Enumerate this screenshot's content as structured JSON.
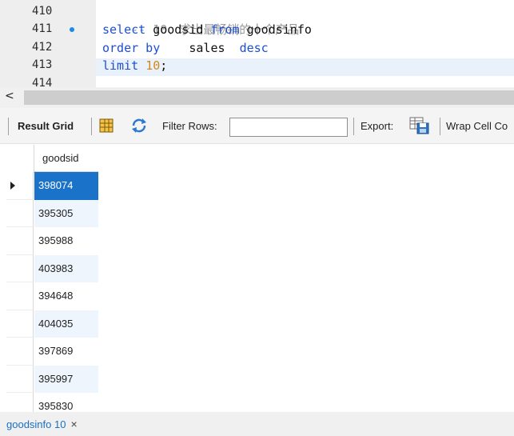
{
  "editor": {
    "lines": [
      {
        "number": "410",
        "comment": "-- 10、求出最畅销的十个产品"
      },
      {
        "number": "411",
        "kw1": "select",
        "id1": " goodsid ",
        "kw2": "from",
        "id2": " goodsinfo"
      },
      {
        "number": "412",
        "kw1": "order by",
        "id1": "    sales  ",
        "kw2": "desc"
      },
      {
        "number": "413",
        "kw1": "limit",
        "num": "10",
        "tail": ";"
      },
      {
        "number": "414"
      }
    ]
  },
  "scrollbar": {
    "left_arrow": "<"
  },
  "toolbar": {
    "result_grid": "Result Grid",
    "filter_rows": "Filter Rows:",
    "filter_value": "",
    "export": "Export:",
    "wrap_cell": "Wrap Cell Co"
  },
  "grid": {
    "column": "goodsid",
    "rows": [
      "398074",
      "395305",
      "395988",
      "403983",
      "394648",
      "404035",
      "397869",
      "395997",
      "395830"
    ]
  },
  "tabs": [
    {
      "label": "goodsinfo 10",
      "close": "×"
    }
  ],
  "colors": {
    "accent": "#1b72c9",
    "keyword": "#1c4fd6",
    "number": "#d7861a",
    "comment": "#9a9a9a"
  }
}
